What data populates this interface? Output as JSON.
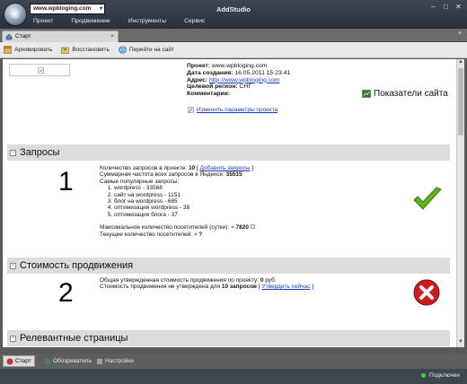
{
  "window": {
    "title": "AddStudio",
    "url": "www.wpbloging.com",
    "controls": [
      "–",
      "□",
      "✕"
    ]
  },
  "menu": [
    "Проект",
    "Продвижение",
    "Инструменты",
    "Сервис"
  ],
  "tabs": {
    "active_label": "Старт",
    "close": "×"
  },
  "toolbar": {
    "archive": "Архивировать",
    "restore": "Восстановить",
    "goto_site": "Перейти на сайт"
  },
  "project": {
    "project_label": "Проект:",
    "project_value": "www.wpbloging.com",
    "created_label": "Дата создания:",
    "created_value": "16.05.2011 15:23:41",
    "address_label": "Адрес:",
    "address_value": "http://www.wpbloging.com",
    "region_label": "Целевой регион:",
    "region_value": "СНГ",
    "comments_label": "Комментарии:",
    "edit_link": "Изменить параметры проекта",
    "metrics_label": "Показатели сайта"
  },
  "sections": {
    "queries": {
      "title": "Запросы",
      "number": "1",
      "count_label": "Количество запросов в проекте:",
      "count_value": "10",
      "add_link": "Добавить запросы",
      "freq_label": "Суммарная частота всех запросов в Яндексе:",
      "freq_value": "35515",
      "popular_label": "Самые популярные запросы:",
      "popular": [
        "wordpress - 33568",
        "сайт на wordpress - 1151",
        "блог на wordpress - 685",
        "оптимизация wordpress - 38",
        "оптимизация блога - 37"
      ],
      "max_visitors_label": "Максимальное количество посетителей (сутки):",
      "max_visitors_value": "7820",
      "current_visitors_label": "Текущее количество посетителей:",
      "current_visitors_value": "?",
      "approx": "≈"
    },
    "cost": {
      "title": "Стоимость продвижения",
      "number": "2",
      "total_label": "Общая утвержденная стоимость продвижения по проекту:",
      "total_value": "0",
      "total_unit": "руб.",
      "unapproved_label": "Стоимость продвижения не утверждена для",
      "unapproved_value": "10 запросов",
      "approve_link": "Утвердить сейчас"
    },
    "pages": {
      "title": "Релевантные страницы"
    }
  },
  "bottom_tabs": [
    "Старт",
    "Обозреватель",
    "Настройки"
  ],
  "status": {
    "connection": "Подключен"
  },
  "colors": {
    "ok": "#5bb31f",
    "error": "#cc1d1d",
    "link": "#1a3fb8"
  }
}
